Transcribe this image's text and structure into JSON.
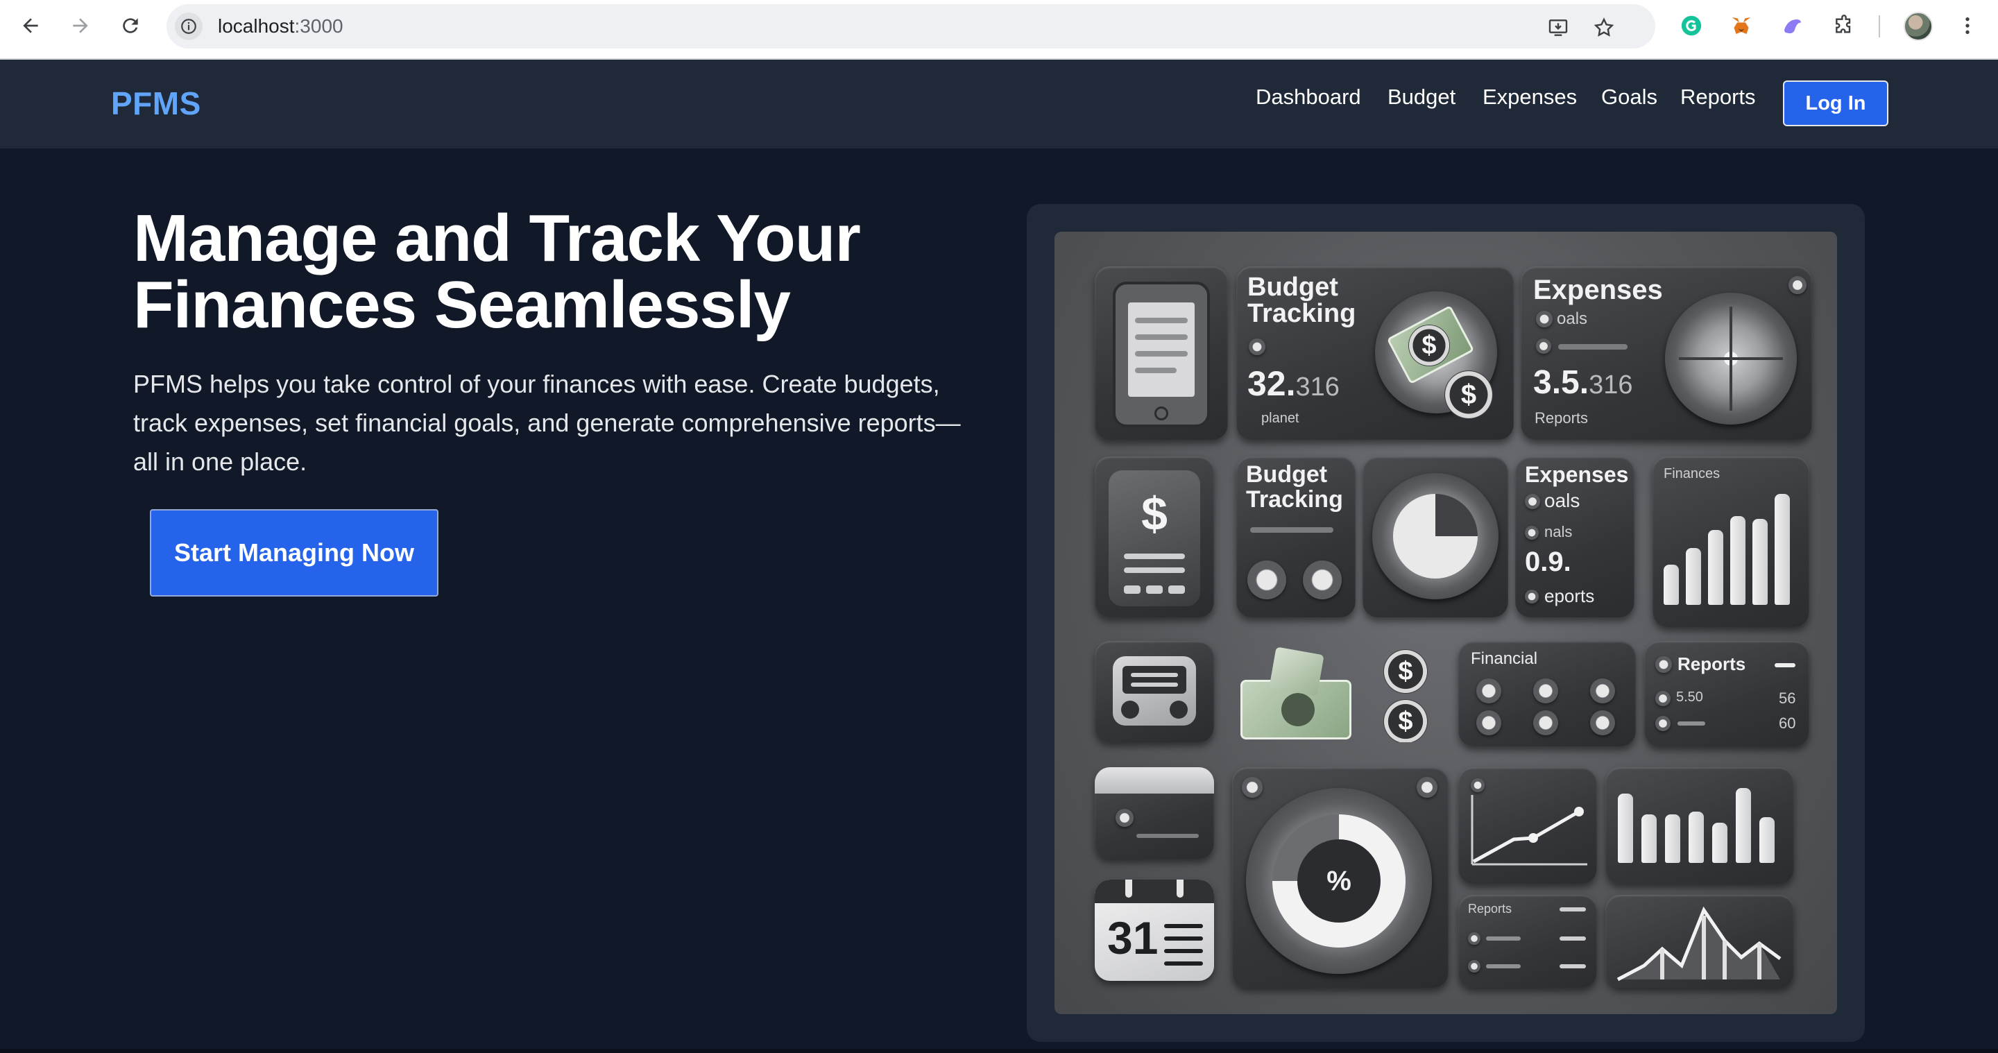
{
  "browser": {
    "url_host": "localhost",
    "url_port": ":3000"
  },
  "navbar": {
    "brand": "PFMS",
    "links": [
      "Dashboard",
      "Budget",
      "Expenses",
      "Goals",
      "Reports"
    ],
    "login_label": "Log In"
  },
  "hero": {
    "title_line1": "Manage and Track Your",
    "title_line2": "Finances Seamlessly",
    "subtitle_line1": "PFMS helps you take control of your finances with ease. Create budgets,",
    "subtitle_line2": "track expenses, set financial goals, and generate comprehensive reports—",
    "subtitle_line3": "all in one place.",
    "cta_label": "Start Managing Now"
  },
  "illustration": {
    "budget_tracking_1": "Budget",
    "budget_tracking_2": "Tracking",
    "budget_value": "32.",
    "budget_value_small": "316",
    "budget_caption": "planet",
    "expenses_title": "Expenses",
    "expenses_sub": "oals",
    "expenses_value": "3.5.",
    "expenses_value_small": "316",
    "expenses_caption": "Reports",
    "budget2_line1": "Budget",
    "budget2_line2": "Tracking",
    "expenses2_title": "Expenses",
    "expenses2_goals": "oals",
    "expenses2_nals": "nals",
    "expenses2_value": "0.9.",
    "expenses2_reports": "eports",
    "finance_chart_title": "Finances",
    "financial_title": "Financial",
    "reports_title": "Reports",
    "reports_row1": "5.50",
    "reports_row1_right": "56",
    "reports_row2_right": "60",
    "reports_small_title": "Reports",
    "calendar_day": "31",
    "dollar_sign": "$",
    "percent_sign": "%"
  }
}
